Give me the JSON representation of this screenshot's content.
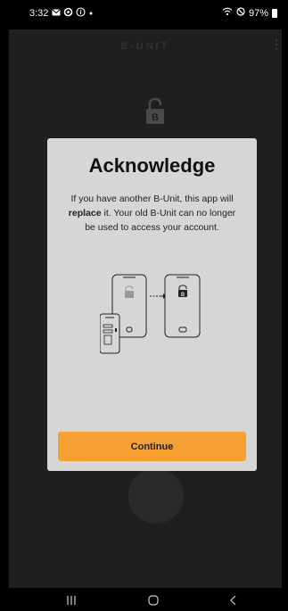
{
  "status_bar": {
    "time": "3:32",
    "battery": "97%",
    "icons": [
      "mail-icon",
      "sync-icon",
      "info-icon",
      "dot-icon",
      "wifi-icon",
      "do-not-disturb-icon",
      "battery-icon"
    ]
  },
  "app": {
    "title": "B-UNIT",
    "lock_letter": "B"
  },
  "modal": {
    "title": "Acknowledge",
    "body_part1": "If you have another B-Unit, this app will ",
    "body_bold": "replace",
    "body_part2": " it. Your old B-Unit can no longer be used to access your account.",
    "continue_label": "Continue",
    "illustration_letter": "B"
  },
  "colors": {
    "accent": "#f5a030",
    "modal_bg": "#d6d6d6",
    "background": "#000000"
  }
}
